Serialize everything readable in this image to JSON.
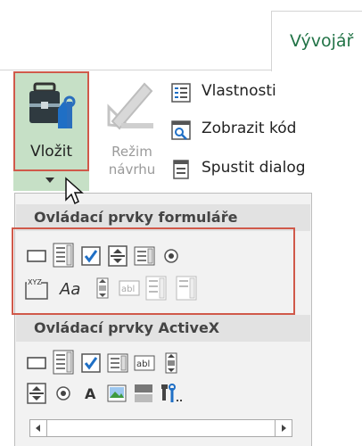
{
  "ribbon": {
    "tab_developer": "Vývojář",
    "insert_label": "Vložit",
    "design_mode_label_line1": "Režim",
    "design_mode_label_line2": "návrhu",
    "properties_label": "Vlastnosti",
    "view_code_label": "Zobrazit kód",
    "run_dialog_label": "Spustit dialog"
  },
  "dropdown": {
    "form_controls_header": "Ovládací prvky formuláře",
    "activex_controls_header": "Ovládací prvky ActiveX",
    "form_row1": [
      "button-icon",
      "combo-box-icon",
      "checkbox-icon",
      "spin-button-icon",
      "list-box-icon",
      "option-button-icon"
    ],
    "form_row2": [
      "group-box-icon",
      "label-icon",
      "scroll-bar-icon",
      "text-field-icon",
      "combo-list-edit-icon",
      "combo-drop-down-edit-icon"
    ],
    "activex_row1": [
      "command-button-icon",
      "combo-box-icon",
      "checkbox-icon",
      "list-box-icon",
      "text-box-icon",
      "scroll-bar-icon"
    ],
    "activex_row2": [
      "spin-button-icon",
      "option-button-icon",
      "label-icon",
      "image-icon",
      "toggle-button-icon",
      "more-controls-icon"
    ]
  },
  "colors": {
    "accent": "#217346",
    "highlight": "#c6e0c6",
    "callout": "#d0594a",
    "check": "#1f6fc5"
  }
}
